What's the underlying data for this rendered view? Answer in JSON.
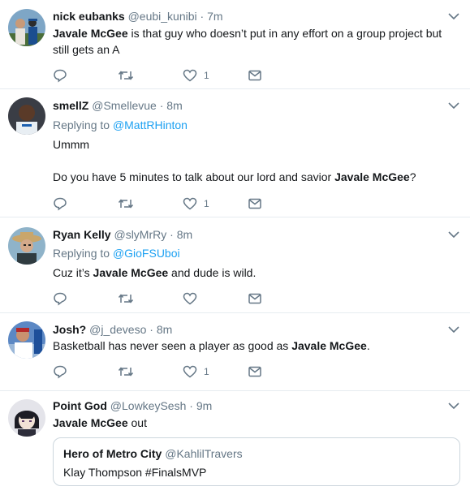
{
  "tweets": [
    {
      "name": "nick eubanks",
      "handle": "@eubi_kunibi",
      "time": "7m",
      "body": [
        {
          "bold": "Javale McGee",
          "after": " is that guy who doesn’t put in any effort on a group project but"
        }
      ],
      "body2": "still gets an A",
      "likes": "1"
    },
    {
      "name": "smellZ",
      "handle": "@Smellevue",
      "time": "8m",
      "replying_label": "Replying to",
      "replying_to": "@MattRHinton",
      "line1": "Ummm",
      "line2_before": "Do you have 5 minutes to talk about our lord and savior ",
      "line2_bold": "Javale McGee",
      "line2_after": "?",
      "likes": "1"
    },
    {
      "name": "Ryan Kelly",
      "handle": "@slyMrRy",
      "time": "8m",
      "replying_label": "Replying to",
      "replying_to": "@GioFSUboi",
      "before": "Cuz it’s ",
      "bold": "Javale McGee",
      "after": " and dude is wild."
    },
    {
      "name": "Josh?",
      "handle": "@j_deveso",
      "time": "8m",
      "before": "Basketball has never seen a player as good as ",
      "bold": "Javale McGee",
      "after": ".",
      "likes": "1"
    },
    {
      "name": "Point God",
      "handle": "@LowkeySesh",
      "time": "9m",
      "bold": "Javale McGee",
      "after": " out",
      "quote": {
        "name": "Hero of Metro City",
        "handle": "@KahlilTravers",
        "text": "Klay Thompson #FinalsMVP"
      }
    }
  ],
  "separator": "·",
  "colors": {
    "link": "#1da1f2",
    "muted": "#657786",
    "border": "#e6ecf0"
  },
  "icons": [
    "reply-icon",
    "retweet-icon",
    "like-icon",
    "message-icon",
    "chevron-down-icon"
  ]
}
